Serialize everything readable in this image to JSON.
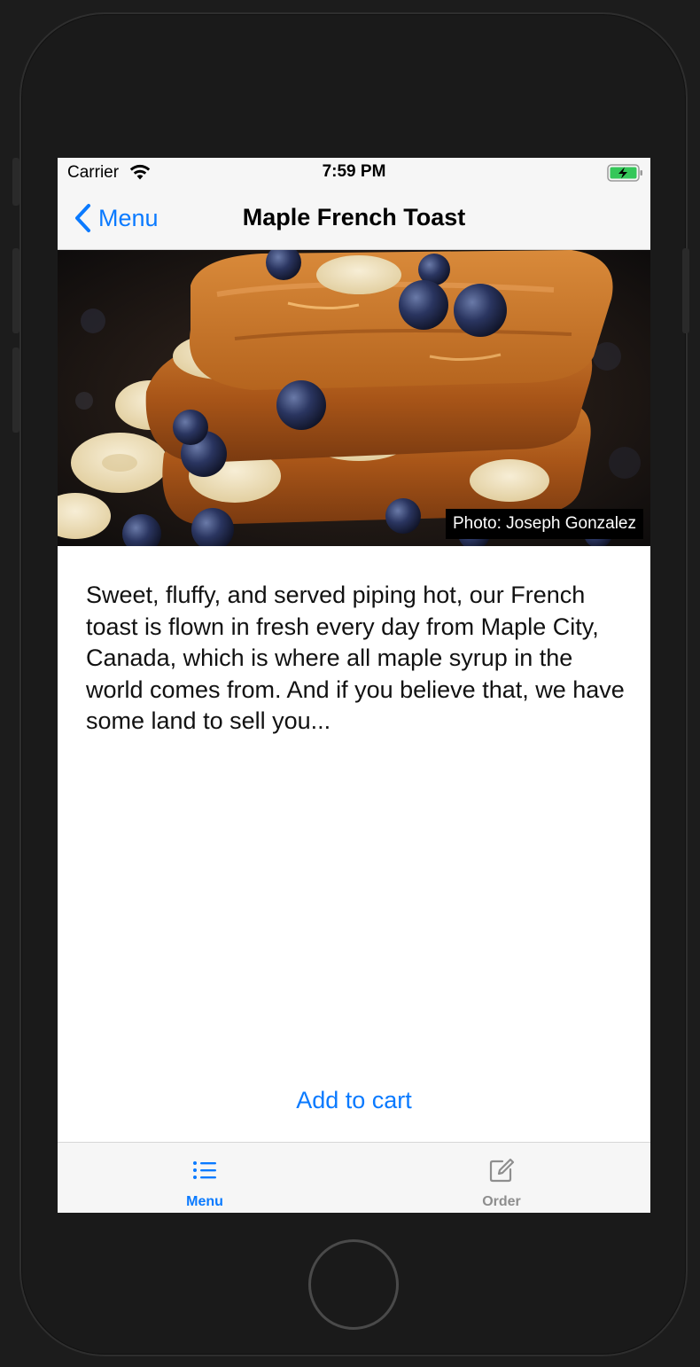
{
  "status_bar": {
    "carrier": "Carrier",
    "time": "7:59 PM",
    "battery_color": "#34c759"
  },
  "nav": {
    "back_label": "Menu",
    "title": "Maple French Toast"
  },
  "hero": {
    "image_subject": "french-toast-photo",
    "credit": "Photo: Joseph Gonzalez"
  },
  "description": "Sweet, fluffy, and served piping hot, our French toast is flown in fresh every day from Maple City, Canada, which is where all maple syrup in the world comes from. And if you believe that, we have some land to sell you...",
  "actions": {
    "add_to_cart": "Add to cart"
  },
  "tabs": [
    {
      "label": "Menu",
      "icon": "list-icon",
      "selected": true
    },
    {
      "label": "Order",
      "icon": "compose-icon",
      "selected": false
    }
  ],
  "colors": {
    "accent": "#0a7aff",
    "tab_inactive": "#8e8e8e",
    "bar_background": "#f6f6f6"
  }
}
